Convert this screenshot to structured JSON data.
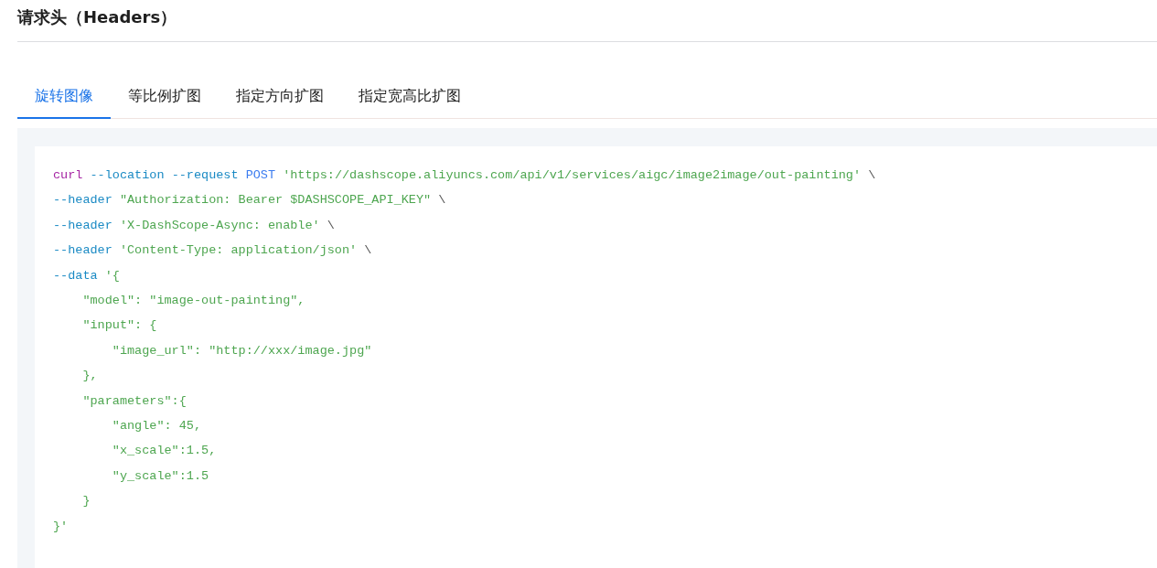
{
  "section_title": "请求头（Headers）",
  "tabs": [
    {
      "label": "旋转图像",
      "selected": true
    },
    {
      "label": "等比例扩图",
      "selected": false
    },
    {
      "label": "指定方向扩图",
      "selected": false
    },
    {
      "label": "指定宽高比扩图",
      "selected": false
    }
  ],
  "code_lines": [
    [
      {
        "kind": "keyword",
        "text": "curl "
      },
      {
        "kind": "option",
        "text": "--location "
      },
      {
        "kind": "option",
        "text": "--request "
      },
      {
        "kind": "method",
        "text": "POST "
      },
      {
        "kind": "string",
        "text": "'https://dashscope.aliyuncs.com/api/v1/services/aigc/image2image/out-painting'"
      },
      {
        "kind": "plain",
        "text": " \\"
      }
    ],
    [
      {
        "kind": "option",
        "text": "--header "
      },
      {
        "kind": "string",
        "text": "\"Authorization: Bearer $DASHSCOPE_API_KEY\""
      },
      {
        "kind": "plain",
        "text": " \\"
      }
    ],
    [
      {
        "kind": "option",
        "text": "--header "
      },
      {
        "kind": "string",
        "text": "'X-DashScope-Async: enable'"
      },
      {
        "kind": "plain",
        "text": " \\"
      }
    ],
    [
      {
        "kind": "option",
        "text": "--header "
      },
      {
        "kind": "string",
        "text": "'Content-Type: application/json'"
      },
      {
        "kind": "plain",
        "text": " \\"
      }
    ],
    [
      {
        "kind": "option",
        "text": "--data "
      },
      {
        "kind": "string",
        "text": "'{"
      }
    ],
    [
      {
        "kind": "string",
        "text": "    \"model\": \"image-out-painting\","
      }
    ],
    [
      {
        "kind": "string",
        "text": "    \"input\": {"
      }
    ],
    [
      {
        "kind": "string",
        "text": "        \"image_url\": \"http://xxx/image.jpg\""
      }
    ],
    [
      {
        "kind": "string",
        "text": "    },"
      }
    ],
    [
      {
        "kind": "string",
        "text": "    \"parameters\":{"
      }
    ],
    [
      {
        "kind": "string",
        "text": "        \"angle\": 45,"
      }
    ],
    [
      {
        "kind": "string",
        "text": "        \"x_scale\":1.5,"
      }
    ],
    [
      {
        "kind": "string",
        "text": "        \"y_scale\":1.5"
      }
    ],
    [
      {
        "kind": "string",
        "text": "    }"
      }
    ],
    [
      {
        "kind": "string",
        "text": "}'"
      }
    ]
  ]
}
